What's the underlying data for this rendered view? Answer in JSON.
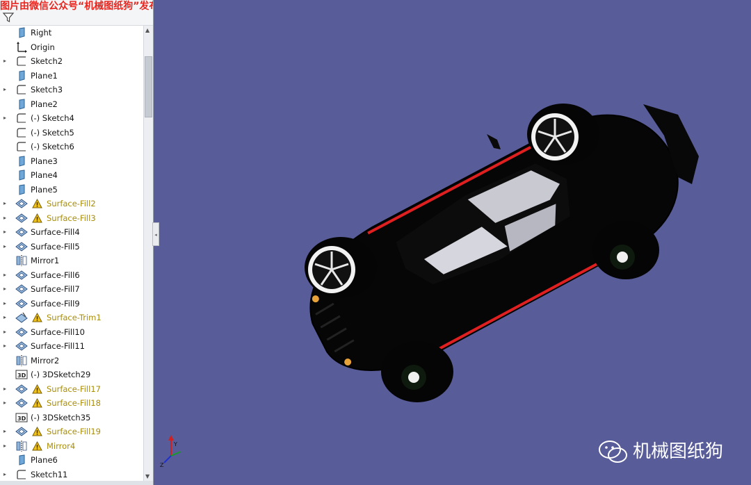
{
  "watermark": {
    "top_text": "图片由微信公众号“机械图纸狗”发布",
    "bottom_text": "机械图纸狗"
  },
  "tree": {
    "items": [
      {
        "label": "Right",
        "icon": "plane-icon",
        "expander": false,
        "warning": false
      },
      {
        "label": "Origin",
        "icon": "origin-icon",
        "expander": false,
        "warning": false
      },
      {
        "label": "Sketch2",
        "icon": "sketch-icon",
        "expander": true,
        "warning": false
      },
      {
        "label": "Plane1",
        "icon": "plane-icon",
        "expander": false,
        "warning": false
      },
      {
        "label": "Sketch3",
        "icon": "sketch-icon",
        "expander": true,
        "warning": false
      },
      {
        "label": "Plane2",
        "icon": "plane-icon",
        "expander": false,
        "warning": false
      },
      {
        "label": "(-) Sketch4",
        "icon": "sketch-icon",
        "expander": true,
        "warning": false
      },
      {
        "label": "(-) Sketch5",
        "icon": "sketch-icon",
        "expander": false,
        "warning": false
      },
      {
        "label": "(-) Sketch6",
        "icon": "sketch-icon",
        "expander": false,
        "warning": false
      },
      {
        "label": "Plane3",
        "icon": "plane-icon",
        "expander": false,
        "warning": false
      },
      {
        "label": "Plane4",
        "icon": "plane-icon",
        "expander": false,
        "warning": false
      },
      {
        "label": "Plane5",
        "icon": "plane-icon",
        "expander": false,
        "warning": false
      },
      {
        "label": "Surface-Fill2",
        "icon": "surface-fill-icon",
        "expander": true,
        "warning": true
      },
      {
        "label": "Surface-Fill3",
        "icon": "surface-fill-icon",
        "expander": true,
        "warning": true
      },
      {
        "label": "Surface-Fill4",
        "icon": "surface-fill-icon",
        "expander": true,
        "warning": false
      },
      {
        "label": "Surface-Fill5",
        "icon": "surface-fill-icon",
        "expander": true,
        "warning": false
      },
      {
        "label": "Mirror1",
        "icon": "mirror-icon",
        "expander": false,
        "warning": false
      },
      {
        "label": "Surface-Fill6",
        "icon": "surface-fill-icon",
        "expander": true,
        "warning": false
      },
      {
        "label": "Surface-Fill7",
        "icon": "surface-fill-icon",
        "expander": true,
        "warning": false
      },
      {
        "label": "Surface-Fill9",
        "icon": "surface-fill-icon",
        "expander": true,
        "warning": false
      },
      {
        "label": "Surface-Trim1",
        "icon": "surface-trim-icon",
        "expander": true,
        "warning": true
      },
      {
        "label": "Surface-Fill10",
        "icon": "surface-fill-icon",
        "expander": true,
        "warning": false
      },
      {
        "label": "Surface-Fill11",
        "icon": "surface-fill-icon",
        "expander": true,
        "warning": false
      },
      {
        "label": "Mirror2",
        "icon": "mirror-icon",
        "expander": false,
        "warning": false
      },
      {
        "label": "(-) 3DSketch29",
        "icon": "3dsketch-icon",
        "expander": false,
        "warning": false
      },
      {
        "label": "Surface-Fill17",
        "icon": "surface-fill-icon",
        "expander": true,
        "warning": true
      },
      {
        "label": "Surface-Fill18",
        "icon": "surface-fill-icon",
        "expander": true,
        "warning": true
      },
      {
        "label": "(-) 3DSketch35",
        "icon": "3dsketch-icon",
        "expander": false,
        "warning": false
      },
      {
        "label": "Surface-Fill19",
        "icon": "surface-fill-icon",
        "expander": true,
        "warning": true
      },
      {
        "label": "Mirror4",
        "icon": "mirror-icon",
        "expander": true,
        "warning": true
      },
      {
        "label": "Plane6",
        "icon": "plane-icon",
        "expander": false,
        "warning": false
      },
      {
        "label": "Sketch11",
        "icon": "sketch-icon",
        "expander": true,
        "warning": false
      }
    ]
  },
  "triad": {
    "y_label": "Y",
    "z_label": "Z"
  },
  "colors": {
    "viewport_bg": "#585c98",
    "warning_text": "#a88d08",
    "warning_icon": "#f2c417",
    "body_stripe": "#e02020"
  }
}
